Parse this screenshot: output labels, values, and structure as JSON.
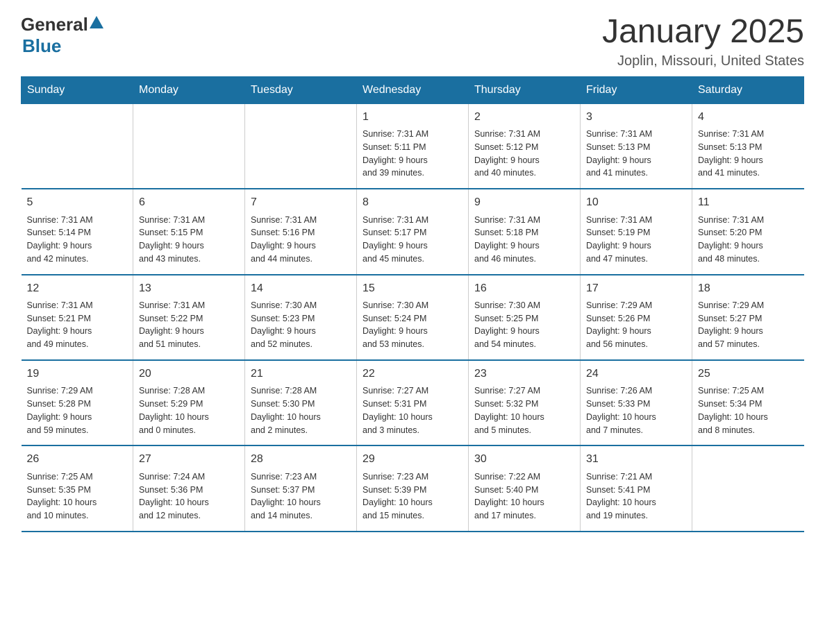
{
  "header": {
    "logo_general": "General",
    "logo_blue": "Blue",
    "month_title": "January 2025",
    "location": "Joplin, Missouri, United States"
  },
  "days_of_week": [
    "Sunday",
    "Monday",
    "Tuesday",
    "Wednesday",
    "Thursday",
    "Friday",
    "Saturday"
  ],
  "weeks": [
    [
      {
        "day": "",
        "info": ""
      },
      {
        "day": "",
        "info": ""
      },
      {
        "day": "",
        "info": ""
      },
      {
        "day": "1",
        "info": "Sunrise: 7:31 AM\nSunset: 5:11 PM\nDaylight: 9 hours\nand 39 minutes."
      },
      {
        "day": "2",
        "info": "Sunrise: 7:31 AM\nSunset: 5:12 PM\nDaylight: 9 hours\nand 40 minutes."
      },
      {
        "day": "3",
        "info": "Sunrise: 7:31 AM\nSunset: 5:13 PM\nDaylight: 9 hours\nand 41 minutes."
      },
      {
        "day": "4",
        "info": "Sunrise: 7:31 AM\nSunset: 5:13 PM\nDaylight: 9 hours\nand 41 minutes."
      }
    ],
    [
      {
        "day": "5",
        "info": "Sunrise: 7:31 AM\nSunset: 5:14 PM\nDaylight: 9 hours\nand 42 minutes."
      },
      {
        "day": "6",
        "info": "Sunrise: 7:31 AM\nSunset: 5:15 PM\nDaylight: 9 hours\nand 43 minutes."
      },
      {
        "day": "7",
        "info": "Sunrise: 7:31 AM\nSunset: 5:16 PM\nDaylight: 9 hours\nand 44 minutes."
      },
      {
        "day": "8",
        "info": "Sunrise: 7:31 AM\nSunset: 5:17 PM\nDaylight: 9 hours\nand 45 minutes."
      },
      {
        "day": "9",
        "info": "Sunrise: 7:31 AM\nSunset: 5:18 PM\nDaylight: 9 hours\nand 46 minutes."
      },
      {
        "day": "10",
        "info": "Sunrise: 7:31 AM\nSunset: 5:19 PM\nDaylight: 9 hours\nand 47 minutes."
      },
      {
        "day": "11",
        "info": "Sunrise: 7:31 AM\nSunset: 5:20 PM\nDaylight: 9 hours\nand 48 minutes."
      }
    ],
    [
      {
        "day": "12",
        "info": "Sunrise: 7:31 AM\nSunset: 5:21 PM\nDaylight: 9 hours\nand 49 minutes."
      },
      {
        "day": "13",
        "info": "Sunrise: 7:31 AM\nSunset: 5:22 PM\nDaylight: 9 hours\nand 51 minutes."
      },
      {
        "day": "14",
        "info": "Sunrise: 7:30 AM\nSunset: 5:23 PM\nDaylight: 9 hours\nand 52 minutes."
      },
      {
        "day": "15",
        "info": "Sunrise: 7:30 AM\nSunset: 5:24 PM\nDaylight: 9 hours\nand 53 minutes."
      },
      {
        "day": "16",
        "info": "Sunrise: 7:30 AM\nSunset: 5:25 PM\nDaylight: 9 hours\nand 54 minutes."
      },
      {
        "day": "17",
        "info": "Sunrise: 7:29 AM\nSunset: 5:26 PM\nDaylight: 9 hours\nand 56 minutes."
      },
      {
        "day": "18",
        "info": "Sunrise: 7:29 AM\nSunset: 5:27 PM\nDaylight: 9 hours\nand 57 minutes."
      }
    ],
    [
      {
        "day": "19",
        "info": "Sunrise: 7:29 AM\nSunset: 5:28 PM\nDaylight: 9 hours\nand 59 minutes."
      },
      {
        "day": "20",
        "info": "Sunrise: 7:28 AM\nSunset: 5:29 PM\nDaylight: 10 hours\nand 0 minutes."
      },
      {
        "day": "21",
        "info": "Sunrise: 7:28 AM\nSunset: 5:30 PM\nDaylight: 10 hours\nand 2 minutes."
      },
      {
        "day": "22",
        "info": "Sunrise: 7:27 AM\nSunset: 5:31 PM\nDaylight: 10 hours\nand 3 minutes."
      },
      {
        "day": "23",
        "info": "Sunrise: 7:27 AM\nSunset: 5:32 PM\nDaylight: 10 hours\nand 5 minutes."
      },
      {
        "day": "24",
        "info": "Sunrise: 7:26 AM\nSunset: 5:33 PM\nDaylight: 10 hours\nand 7 minutes."
      },
      {
        "day": "25",
        "info": "Sunrise: 7:25 AM\nSunset: 5:34 PM\nDaylight: 10 hours\nand 8 minutes."
      }
    ],
    [
      {
        "day": "26",
        "info": "Sunrise: 7:25 AM\nSunset: 5:35 PM\nDaylight: 10 hours\nand 10 minutes."
      },
      {
        "day": "27",
        "info": "Sunrise: 7:24 AM\nSunset: 5:36 PM\nDaylight: 10 hours\nand 12 minutes."
      },
      {
        "day": "28",
        "info": "Sunrise: 7:23 AM\nSunset: 5:37 PM\nDaylight: 10 hours\nand 14 minutes."
      },
      {
        "day": "29",
        "info": "Sunrise: 7:23 AM\nSunset: 5:39 PM\nDaylight: 10 hours\nand 15 minutes."
      },
      {
        "day": "30",
        "info": "Sunrise: 7:22 AM\nSunset: 5:40 PM\nDaylight: 10 hours\nand 17 minutes."
      },
      {
        "day": "31",
        "info": "Sunrise: 7:21 AM\nSunset: 5:41 PM\nDaylight: 10 hours\nand 19 minutes."
      },
      {
        "day": "",
        "info": ""
      }
    ]
  ]
}
